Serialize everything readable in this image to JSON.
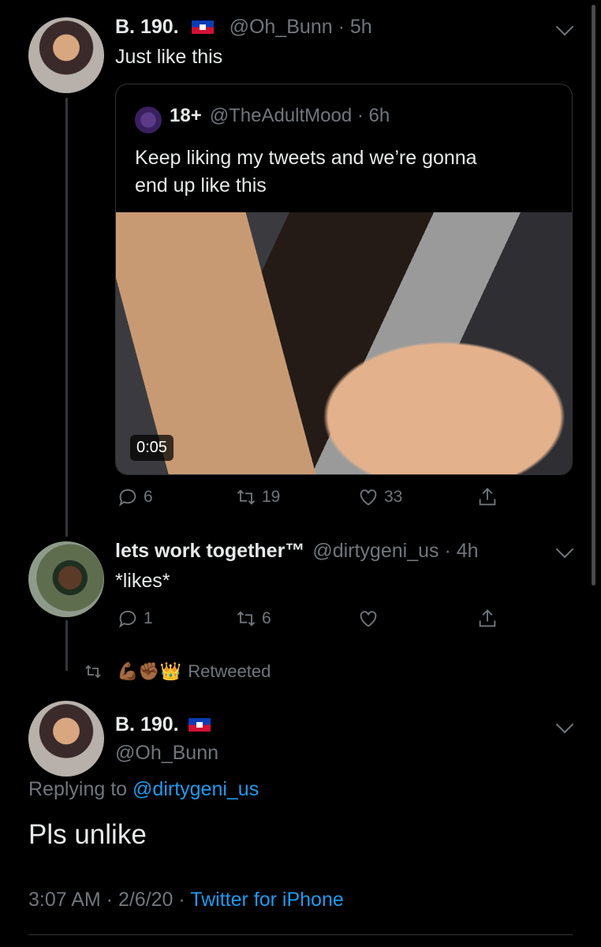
{
  "tweet1": {
    "name": "B. 190.",
    "handle_time": "@Oh_Bunn · 5h",
    "text": "Just like this",
    "quoted": {
      "name": "18+",
      "handle_time": "@TheAdultMood · 6h",
      "text_line1": "Keep liking my tweets and we’re gonna",
      "text_line2": "end up like this",
      "duration": "0:05"
    },
    "replies": "6",
    "retweets": "19",
    "likes": "33"
  },
  "tweet2": {
    "name": "lets work together™",
    "handle_time": "@dirtygeni_us · 4h",
    "text": "*likes*",
    "replies": "1",
    "retweets": "6"
  },
  "retweeted": {
    "emojis": "💪🏾✊🏾👑",
    "label": "Retweeted"
  },
  "tweet3": {
    "name": "B. 190.",
    "handle": "@Oh_Bunn",
    "replying_prefix": "Replying to ",
    "replying_handle": "@dirtygeni_us",
    "text": "Pls unlike",
    "time_date": "3:07 AM · 2/6/20 · ",
    "source": "Twitter for iPhone"
  },
  "colors": {
    "background": "#000000",
    "text": "#e7e9ea",
    "muted": "#71767b",
    "link": "#1d9bf0"
  }
}
